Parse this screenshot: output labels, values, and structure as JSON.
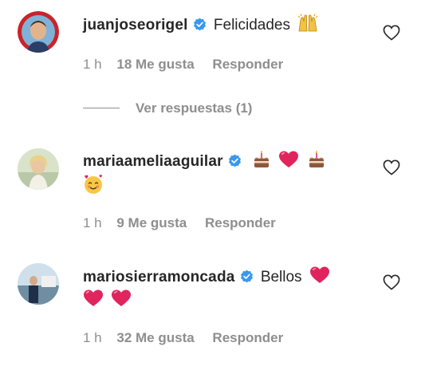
{
  "comments": [
    {
      "username": "juanjoseorigel",
      "text": "Felicidades",
      "emojis_line1": [
        "raising-hands-emoji"
      ],
      "emojis_line2": [],
      "time": "1 h",
      "likes": "18 Me gusta",
      "reply": "Responder",
      "view_replies": "Ver respuestas (1)"
    },
    {
      "username": "mariaameliaaguilar",
      "text": "",
      "emojis_line1": [
        "cake-emoji",
        "heart-emoji",
        "cake-emoji"
      ],
      "emojis_line2": [
        "smiling-face-with-hearts-emoji"
      ],
      "time": "1 h",
      "likes": "9 Me gusta",
      "reply": "Responder"
    },
    {
      "username": "mariosierramoncada",
      "text": "Bellos",
      "emojis_line1": [
        "heart-emoji"
      ],
      "emojis_line2": [
        "heart-emoji",
        "heart-emoji"
      ],
      "time": "1 h",
      "likes": "32 Me gusta",
      "reply": "Responder"
    }
  ],
  "colors": {
    "text": "#262626",
    "muted": "#8e8e8e",
    "verified": "#3897f0",
    "heart": "#e0245e"
  }
}
